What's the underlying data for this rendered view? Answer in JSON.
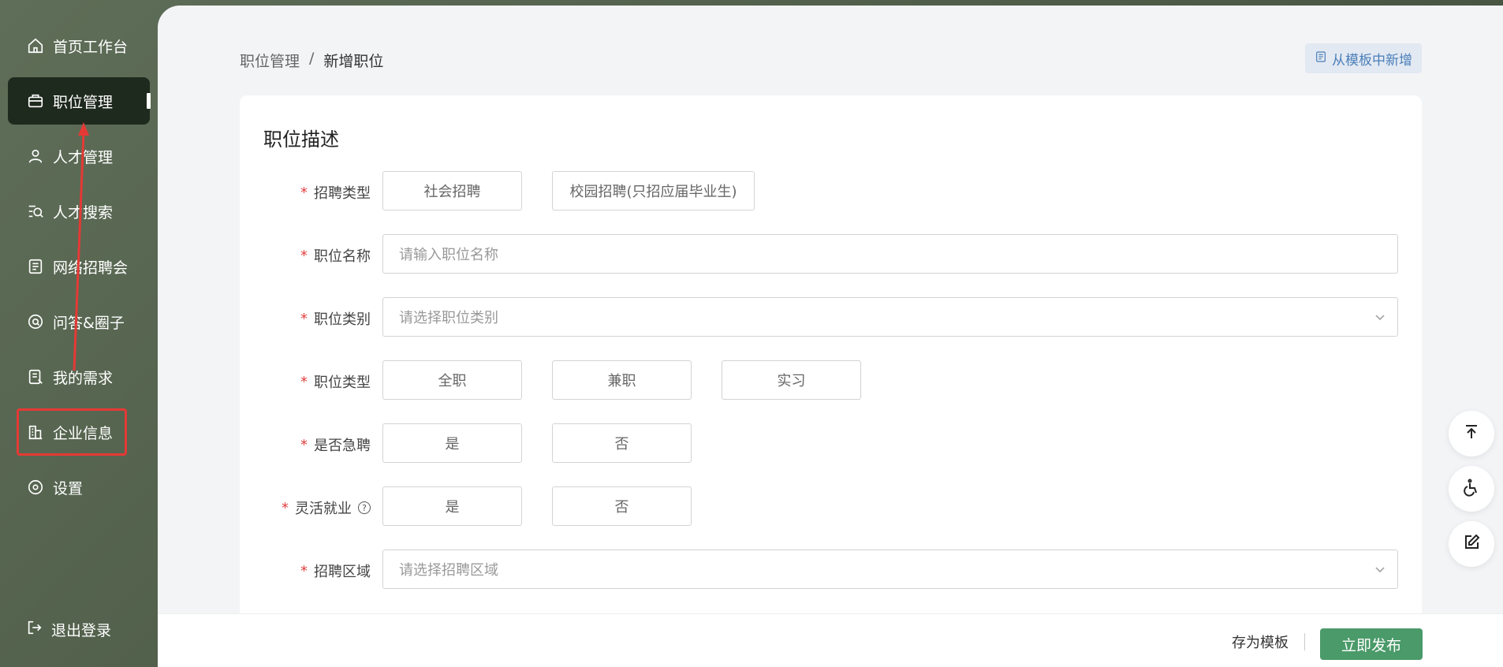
{
  "sidebar": {
    "items": [
      {
        "label": "首页工作台",
        "icon": "home-icon"
      },
      {
        "label": "职位管理",
        "icon": "briefcase-icon"
      },
      {
        "label": "人才管理",
        "icon": "user-icon"
      },
      {
        "label": "人才搜索",
        "icon": "search-list-icon"
      },
      {
        "label": "网络招聘会",
        "icon": "document-icon"
      },
      {
        "label": "问答&圈子",
        "icon": "question-icon"
      },
      {
        "label": "我的需求",
        "icon": "note-icon"
      },
      {
        "label": "企业信息",
        "icon": "building-icon"
      },
      {
        "label": "设置",
        "icon": "settings-icon"
      }
    ],
    "logout_label": "退出登录"
  },
  "header": {
    "breadcrumb_root": "职位管理",
    "breadcrumb_sep": "/",
    "breadcrumb_current": "新增职位",
    "template_button": "从模板中新增"
  },
  "form": {
    "title": "职位描述",
    "recruit_type": {
      "label": "招聘类型",
      "options": [
        "社会招聘",
        "校园招聘(只招应届毕业生)"
      ]
    },
    "job_name": {
      "label": "职位名称",
      "placeholder": "请输入职位名称"
    },
    "job_category": {
      "label": "职位类别",
      "placeholder": "请选择职位类别"
    },
    "job_type": {
      "label": "职位类型",
      "options": [
        "全职",
        "兼职",
        "实习"
      ]
    },
    "urgent": {
      "label": "是否急聘",
      "options": [
        "是",
        "否"
      ]
    },
    "flexible": {
      "label": "灵活就业",
      "options": [
        "是",
        "否"
      ]
    },
    "region": {
      "label": "招聘区域",
      "placeholder": "请选择招聘区域"
    },
    "required_mark": "*"
  },
  "footer": {
    "save_template": "存为模板",
    "publish": "立即发布"
  },
  "colors": {
    "accent_green": "#4b9a6a",
    "active_nav": "#1f2a1f",
    "annotation_red": "#e53935"
  }
}
